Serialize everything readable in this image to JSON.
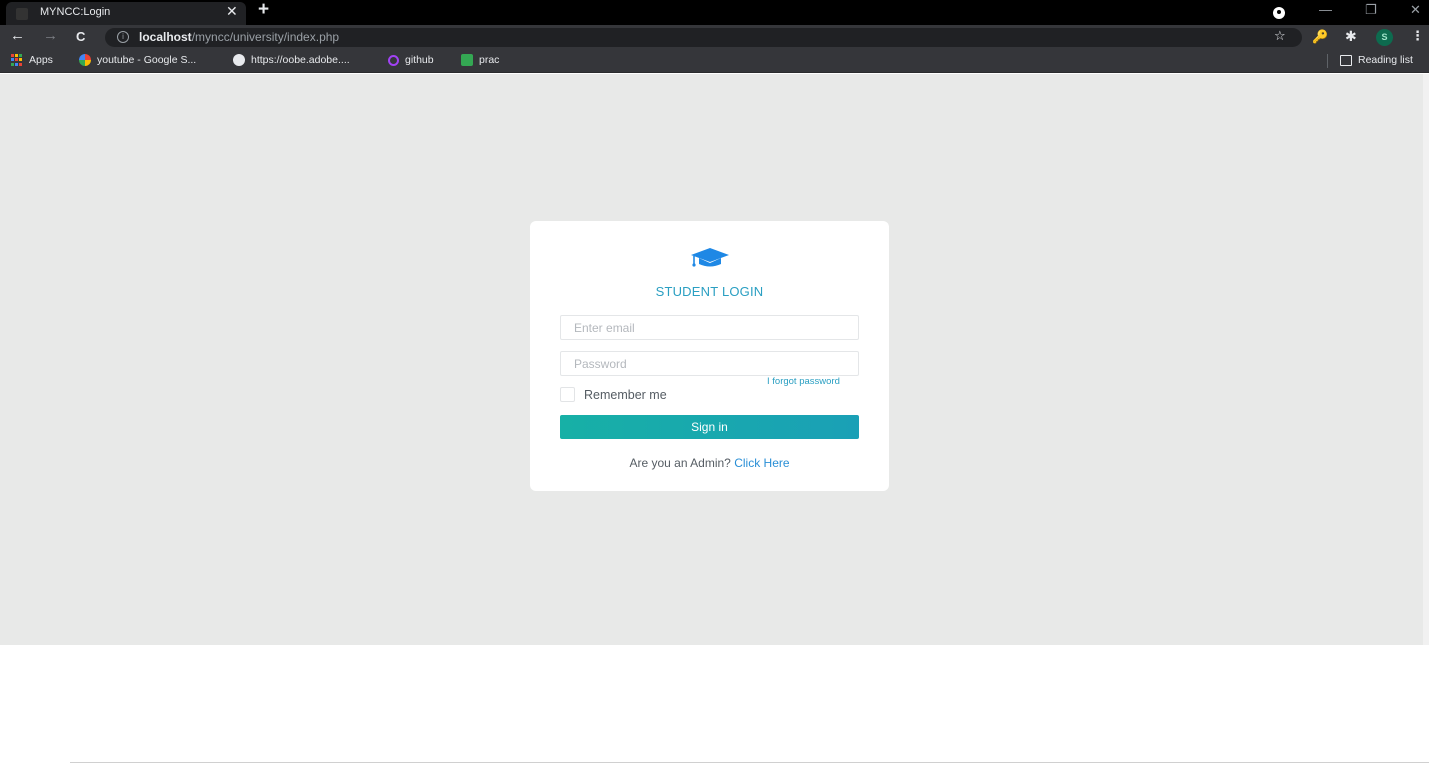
{
  "browser": {
    "tab": {
      "title": "MYNCC:Login",
      "close": "✕"
    },
    "new_tab": "+",
    "window_controls": {
      "minimize": "—",
      "restore": "❐",
      "close": "✕"
    },
    "nav": {
      "back": "←",
      "forward": "→",
      "reload": "C"
    },
    "address": {
      "host": "localhost",
      "path": "/myncc/university/index.php"
    },
    "profile_initial": "S",
    "bookmarks": [
      {
        "label": "Apps",
        "icon": "apps-grid-icon"
      },
      {
        "label": "youtube - Google S...",
        "icon": "google-icon"
      },
      {
        "label": "https://oobe.adobe....",
        "icon": "globe-icon"
      },
      {
        "label": "github",
        "icon": "github-icon"
      },
      {
        "label": "prac",
        "icon": "sheets-icon"
      }
    ],
    "reading_list": "Reading list"
  },
  "login": {
    "title": "STUDENT LOGIN",
    "email_placeholder": "Enter email",
    "password_placeholder": "Password",
    "forgot_password": "I forgot password",
    "remember_me": "Remember me",
    "sign_in": "Sign in",
    "admin_prompt": "Are you an Admin?",
    "admin_link": "Click Here"
  },
  "colors": {
    "accent": "#2a9fc2",
    "button_start": "#17b0a6",
    "button_end": "#1aa0b6",
    "page_bg": "#e8e9e8",
    "icon_blue": "#1e88e5"
  }
}
